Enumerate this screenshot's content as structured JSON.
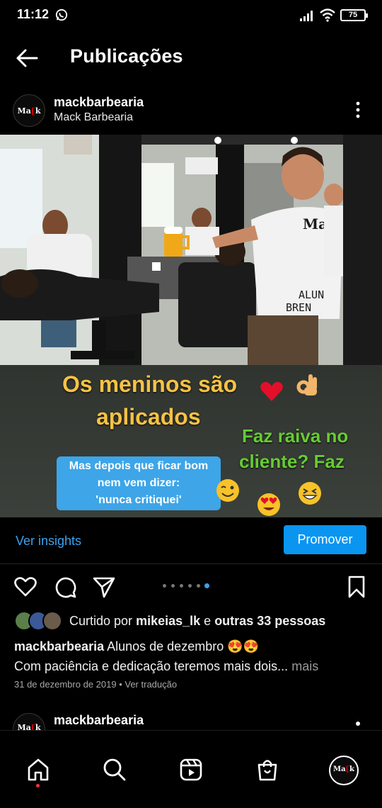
{
  "status_bar": {
    "time": "11:12",
    "battery": "75"
  },
  "header": {
    "title": "Publicações"
  },
  "post": {
    "username": "mackbarbearia",
    "full_name": "Mack Barbearia",
    "avatar_text_a": "Ma",
    "avatar_text_b": "k",
    "image": {
      "line1": "Os meninos são",
      "line2": "aplicados",
      "green1": "Faz raiva no",
      "green2": "cliente? Faz",
      "box1": "Mas depois que ficar bom",
      "box2": "nem vem dizer:",
      "box3": "'nunca critiquei'",
      "shirt_logo": "Mack",
      "shirt_text1": "ALUN",
      "shirt_text2": "BREN"
    },
    "insights_label": "Ver insights",
    "promote_label": "Promover",
    "carousel": {
      "count": 6,
      "active": 5
    },
    "liked_prefix": "Curtido por",
    "liked_user": "mikeias_lk",
    "liked_join": "e",
    "liked_others": "outras 33 pessoas",
    "caption_user": "mackbarbearia",
    "caption_line1": "Alunos de dezembro 😍😍",
    "caption_line2": "Com paciência e dedicação teremos mais dois...",
    "caption_more": "mais",
    "date": "31 de dezembro de 2019",
    "separator": "•",
    "translate": "Ver tradução"
  },
  "next_post": {
    "username": "mackbarbearia"
  },
  "colors": {
    "accent": "#0a95f0",
    "link": "#3ba2ee",
    "caption_yellow": "#f6c244",
    "caption_green": "#66cc33",
    "box_blue": "#3da5e8"
  },
  "icons": {
    "back": "arrow-left-icon",
    "more": "more-vertical-icon",
    "like": "heart-icon",
    "comment": "comment-icon",
    "share": "send-icon",
    "save": "bookmark-icon",
    "home": "home-icon",
    "search": "search-icon",
    "reels": "reels-icon",
    "shop": "shop-icon"
  }
}
